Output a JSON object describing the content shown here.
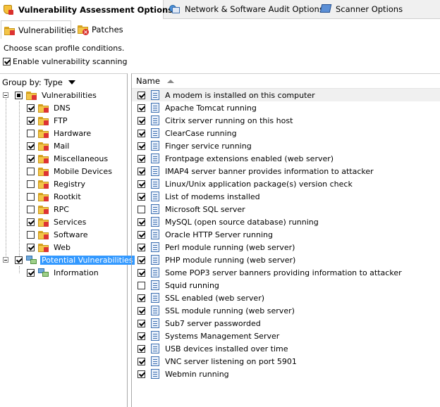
{
  "top_tabs": [
    {
      "label": "Vulnerability Assessment Options",
      "icon": "shield-lock-icon",
      "active": true
    },
    {
      "label": "Network & Software Audit Options",
      "icon": "network-audit-icon",
      "active": false
    },
    {
      "label": "Scanner Options",
      "icon": "scanner-icon",
      "active": false
    }
  ],
  "sub_tabs": [
    {
      "label": "Vulnerabilities",
      "icon": "vulnerabilities-folder-icon",
      "active": true
    },
    {
      "label": "Patches",
      "icon": "patches-icon",
      "active": false
    }
  ],
  "instruction": "Choose scan profile conditions.",
  "enable_scanning": {
    "label": "Enable vulnerability scanning",
    "checked": true
  },
  "group_by": {
    "label": "Group by: Type"
  },
  "tree": {
    "vulnerabilities": {
      "label": "Vulnerabilities",
      "state": "partial",
      "children": [
        {
          "label": "DNS",
          "checked": true
        },
        {
          "label": "FTP",
          "checked": true
        },
        {
          "label": "Hardware",
          "checked": false
        },
        {
          "label": "Mail",
          "checked": true
        },
        {
          "label": "Miscellaneous",
          "checked": true
        },
        {
          "label": "Mobile Devices",
          "checked": false
        },
        {
          "label": "Registry",
          "checked": false
        },
        {
          "label": "Rootkit",
          "checked": false
        },
        {
          "label": "RPC",
          "checked": false
        },
        {
          "label": "Services",
          "checked": true
        },
        {
          "label": "Software",
          "checked": false
        },
        {
          "label": "Web",
          "checked": true
        }
      ]
    },
    "potential": {
      "label": "Potential Vulnerabilities",
      "checked": true,
      "selected": true,
      "children": [
        {
          "label": "Information",
          "checked": true
        }
      ]
    }
  },
  "list": {
    "column_header": "Name",
    "items": [
      {
        "label": "A modem is installed on this computer",
        "checked": true
      },
      {
        "label": "Apache Tomcat running",
        "checked": true
      },
      {
        "label": "Citrix server running on this host",
        "checked": true
      },
      {
        "label": "ClearCase running",
        "checked": true
      },
      {
        "label": "Finger service running",
        "checked": true
      },
      {
        "label": "Frontpage extensions enabled (web server)",
        "checked": true
      },
      {
        "label": "IMAP4 server banner provides information to attacker",
        "checked": true
      },
      {
        "label": "Linux/Unix application package(s) version check",
        "checked": true
      },
      {
        "label": "List of modems installed",
        "checked": true
      },
      {
        "label": "Microsoft SQL server",
        "checked": false
      },
      {
        "label": "MySQL (open source database) running",
        "checked": true
      },
      {
        "label": "Oracle HTTP Server running",
        "checked": true
      },
      {
        "label": "Perl module running (web server)",
        "checked": true
      },
      {
        "label": "PHP module running (web server)",
        "checked": true
      },
      {
        "label": "Some POP3 server banners providing information to attacker",
        "checked": true
      },
      {
        "label": "Squid running",
        "checked": false
      },
      {
        "label": "SSL enabled (web server)",
        "checked": true
      },
      {
        "label": "SSL module running (web server)",
        "checked": true
      },
      {
        "label": "Sub7 server passworded",
        "checked": true
      },
      {
        "label": "Systems Management Server",
        "checked": true
      },
      {
        "label": "USB devices installed over time",
        "checked": true
      },
      {
        "label": "VNC server listening on port 5901",
        "checked": true
      },
      {
        "label": "Webmin running",
        "checked": true
      }
    ]
  },
  "colors": {
    "selection": "#3399ff",
    "tab_bar": "#f0f0f0"
  }
}
